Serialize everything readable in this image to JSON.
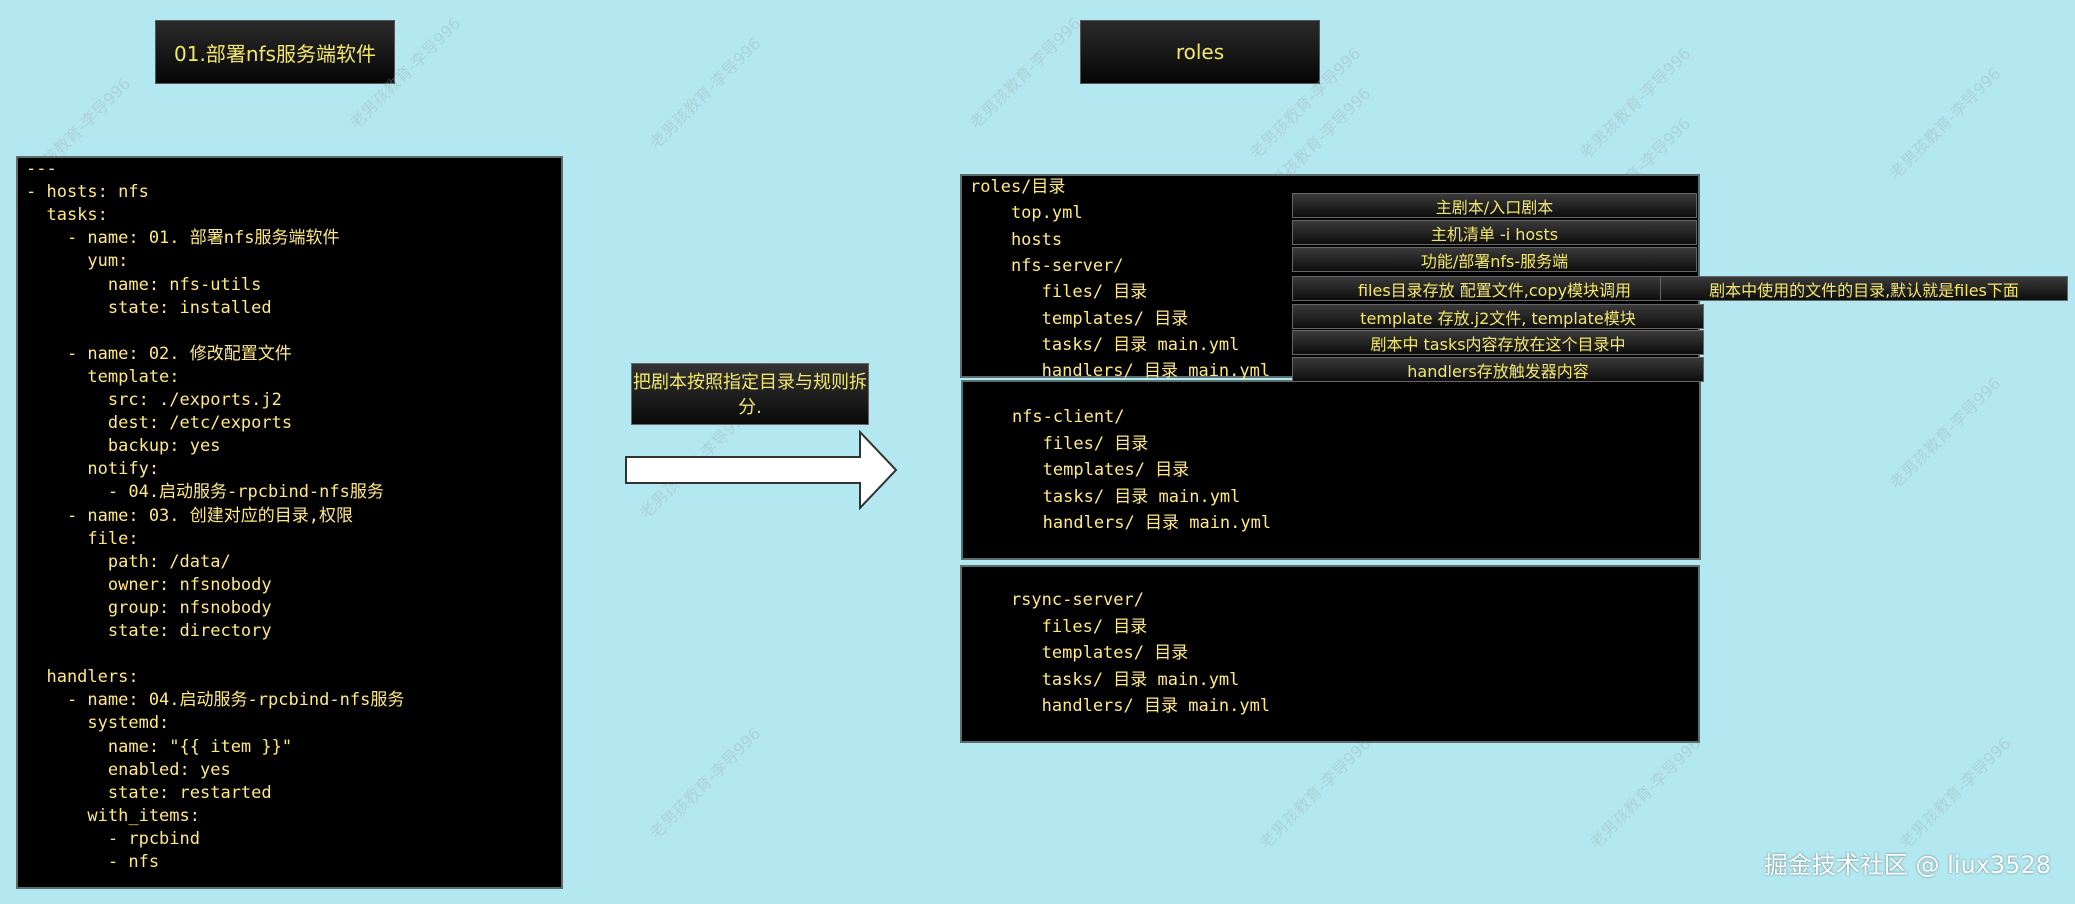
{
  "titles": {
    "left": "01.部署nfs服务端软件",
    "right": "roles"
  },
  "yaml_lines": [
    "---",
    "- hosts: nfs",
    "  tasks:",
    "    - name: 01. 部署nfs服务端软件",
    "      yum:",
    "        name: nfs-utils",
    "        state: installed",
    "",
    "    - name: 02. 修改配置文件",
    "      template:",
    "        src: ./exports.j2",
    "        dest: /etc/exports",
    "        backup: yes",
    "      notify:",
    "        - 04.启动服务-rpcbind-nfs服务",
    "    - name: 03. 创建对应的目录,权限",
    "      file:",
    "        path: /data/",
    "        owner: nfsnobody",
    "        group: nfsnobody",
    "        state: directory",
    "",
    "  handlers:",
    "    - name: 04.启动服务-rpcbind-nfs服务",
    "      systemd:",
    "        name: \"{{ item }}\"",
    "        enabled: yes",
    "        state: restarted",
    "      with_items:",
    "        - rpcbind",
    "        - nfs"
  ],
  "action_label": "把剧本按照指定目录与规则拆分.",
  "roles_server_lines": [
    "roles/目录",
    "    top.yml",
    "    hosts",
    "    nfs-server/",
    "       files/ 目录",
    "       templates/ 目录",
    "       tasks/ 目录 main.yml",
    "       handlers/ 目录 main.yml"
  ],
  "roles_client_lines": [
    "    nfs-client/",
    "       files/ 目录",
    "       templates/ 目录",
    "       tasks/ 目录 main.yml",
    "       handlers/ 目录 main.yml"
  ],
  "roles_rsync_lines": [
    "    rsync-server/",
    "       files/ 目录",
    "       templates/ 目录",
    "       tasks/ 目录 main.yml",
    "       handlers/ 目录 main.yml"
  ],
  "notes": [
    "主剧本/入口剧本",
    "主机清单  -i hosts",
    "功能/部署nfs-服务端",
    "files目录存放 配置文件,copy模块调用",
    "template  存放.j2文件, template模块",
    "剧本中 tasks内容存放在这个目录中",
    "handlers存放触发器内容"
  ],
  "files_note_extra": "剧本中使用的文件的目录,默认就是files下面",
  "footer": "掘金技术社区 @ liux3528",
  "watermark_text": "老男孩教育-李导996",
  "colors": {
    "background": "#b3e8f0",
    "code_text": "#ffe980",
    "panel": "#000000"
  }
}
